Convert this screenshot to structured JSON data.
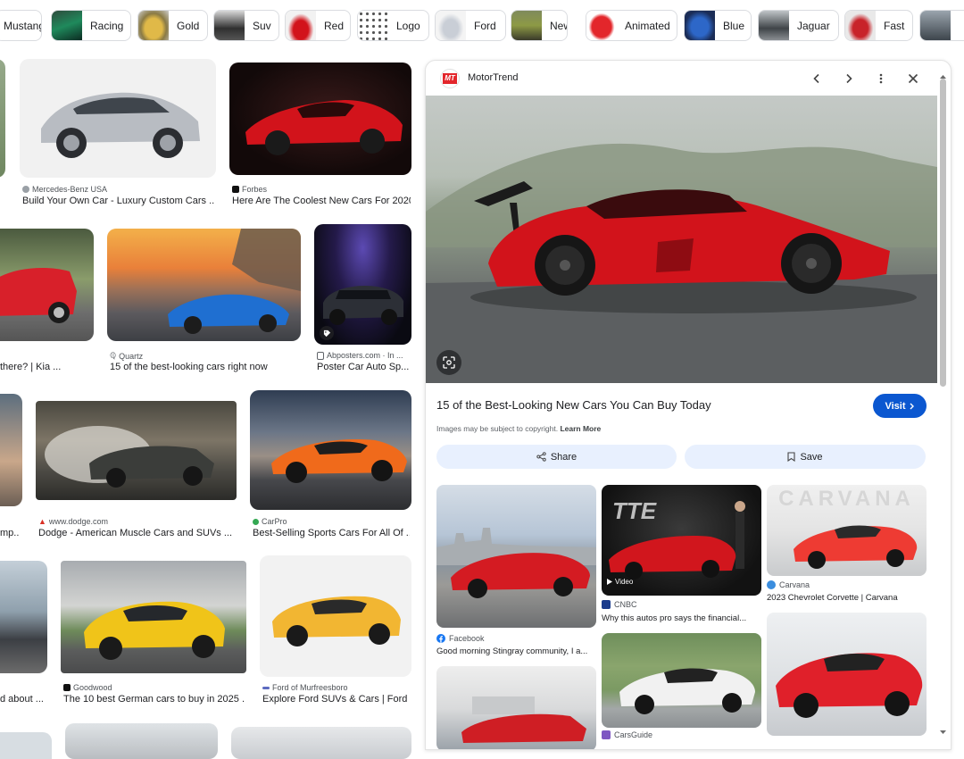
{
  "chips": [
    {
      "label": "Mustang",
      "thumb": "mustang-thumb"
    },
    {
      "label": "Racing",
      "thumb": "racing-thumb"
    },
    {
      "label": "Gold",
      "thumb": "gold-thumb"
    },
    {
      "label": "Suv",
      "thumb": "suv-thumb"
    },
    {
      "label": "Red",
      "thumb": "red-thumb"
    },
    {
      "label": "Logo",
      "thumb": "logo-thumb"
    },
    {
      "label": "Ford",
      "thumb": "ford-thumb"
    },
    {
      "label": "New",
      "thumb": "new-thumb"
    },
    {
      "label": "Animated",
      "thumb": "animated-thumb"
    },
    {
      "label": "Blue",
      "thumb": "blue-thumb"
    },
    {
      "label": "Jaguar",
      "thumb": "jaguar-thumb"
    },
    {
      "label": "Fast",
      "thumb": "fast-thumb"
    }
  ],
  "results": [
    {
      "source": "Mercedes-Benz USA",
      "title": "Build Your Own Car - Luxury Custom Cars ..."
    },
    {
      "source": "Forbes",
      "title": "Here Are The Coolest New Cars For 2020"
    },
    {
      "source": "",
      "title": "there? | Kia ..."
    },
    {
      "source": "Quartz",
      "title": "15 of the best-looking cars right now"
    },
    {
      "source": "Abposters.com · In ...",
      "title": "Poster Car Auto Sp..."
    },
    {
      "source": "",
      "title": "mp..."
    },
    {
      "source": "www.dodge.com",
      "title": "Dodge - American Muscle Cars and SUVs ..."
    },
    {
      "source": "CarPro",
      "title": "Best-Selling Sports Cars For All Of ..."
    },
    {
      "source": "",
      "title": "d about ..."
    },
    {
      "source": "Goodwood",
      "title": "The 10 best German cars to buy in 2025 ..."
    },
    {
      "source": "Ford of Murfreesboro",
      "title": "Explore Ford SUVs & Cars | Ford ..."
    }
  ],
  "panel": {
    "source_name": "MotorTrend",
    "source_logo": "MT",
    "title": "15 of the Best-Looking New Cars You Can Buy Today",
    "visit_label": "Visit",
    "copyright_text": "Images may be subject to copyright.",
    "learn_more": "Learn More",
    "share_label": "Share",
    "save_label": "Save",
    "related": [
      {
        "source": "Facebook",
        "title": "Good morning Stingray community, I a..."
      },
      {
        "source": "CNBC",
        "title": "Why this autos pro says the financial...",
        "badge": "Video"
      },
      {
        "source": "Carvana",
        "title": "2023 Chevrolet Corvette | Carvana"
      },
      {
        "source": "CarsGuide",
        "title": ""
      }
    ],
    "related_overlay_text": "CARVANA"
  },
  "colors": {
    "accent": "#0b57d0",
    "action_bg": "#e8f0fe",
    "car_red": "#d2131b",
    "motortrend_red": "#e3262b"
  }
}
